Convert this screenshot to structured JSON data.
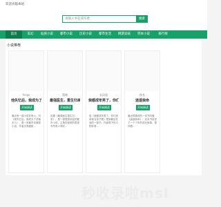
{
  "topbar": {
    "welcome": "欢迎光临本站"
  },
  "search": {
    "placeholder": "请输入书名或作者",
    "button": "搜索"
  },
  "nav": [
    {
      "label": "首页"
    },
    {
      "label": "玄幻"
    },
    {
      "label": "仙侠小说"
    },
    {
      "label": "都市小说"
    },
    {
      "label": "历史小说"
    },
    {
      "label": "都市生活"
    },
    {
      "label": "网游竞技"
    },
    {
      "label": "完本小说"
    },
    {
      "label": "排行榜"
    }
  ],
  "section": {
    "title": "小说推荐"
  },
  "cards": [
    {
      "author": "fezgo",
      "title": "他失忆后，我成为了总...",
      "button": "开始阅读",
      "desc": "最近有一部小说非常火，叫《他失忆后，我成为了总裁夫人》，是一本都市言情类小说，作者文笔细腻..."
    },
    {
      "author": "落笔",
      "title": "最强医生，重生归来，...",
      "button": "开始阅读",
      "desc": "如果《最强医生重生归来》，是一部很受欢迎的都市小说，主角在医院的表现令所有人惊叹..."
    },
    {
      "author": "长风遥",
      "title": "我都成年男了，你们还...",
      "button": "开始阅读",
      "desc": "若《我都成年男了，你们还拿我当孩子看》是我最近在读的一部书，作者笔下的人物非常..."
    },
    {
      "author": "佚名",
      "title": "逍遥我命",
      "button": "开始阅读",
      "desc": "最近很喜欢的一本书叫做《逍遥我命》，这本书讲述了一个少年的成长故事，很好看..."
    }
  ],
  "watermark": "秒收录啦msl"
}
